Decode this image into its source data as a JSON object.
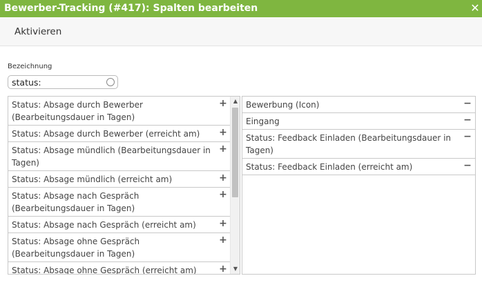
{
  "window": {
    "title": "Bewerber-Tracking (#417): Spalten bearbeiten",
    "close_glyph": "✕"
  },
  "toolbar": {
    "activate_label": "Aktivieren"
  },
  "filter": {
    "label": "Bezeichnung",
    "value": "status:"
  },
  "available": {
    "add_glyph": "+",
    "items": [
      {
        "label": "Status: Absage durch Bewerber (Bearbeitungsdauer in Tagen)"
      },
      {
        "label": "Status: Absage durch Bewerber (erreicht am)"
      },
      {
        "label": "Status: Absage mündlich (Bearbeitungsdauer in Tagen)"
      },
      {
        "label": "Status: Absage mündlich (erreicht am)"
      },
      {
        "label": "Status: Absage nach Gespräch (Bearbeitungsdauer in Tagen)"
      },
      {
        "label": "Status: Absage nach Gespräch (erreicht am)"
      },
      {
        "label": "Status: Absage ohne Gespräch (Bearbeitungsdauer in Tagen)"
      },
      {
        "label": "Status: Absage ohne Gespräch (erreicht am)"
      }
    ],
    "scroll_position": 0.15
  },
  "selected": {
    "remove_glyph": "−",
    "items": [
      {
        "label": "Bewerbung (Icon)"
      },
      {
        "label": "Eingang"
      },
      {
        "label": "Status: Feedback Einladen (Bearbeitungsdauer in Tagen)"
      },
      {
        "label": "Status: Feedback Einladen (erreicht am)"
      }
    ]
  },
  "icons": {
    "close": "close-icon",
    "clear": "clear-search-icon",
    "add": "plus-icon",
    "remove": "minus-icon"
  }
}
